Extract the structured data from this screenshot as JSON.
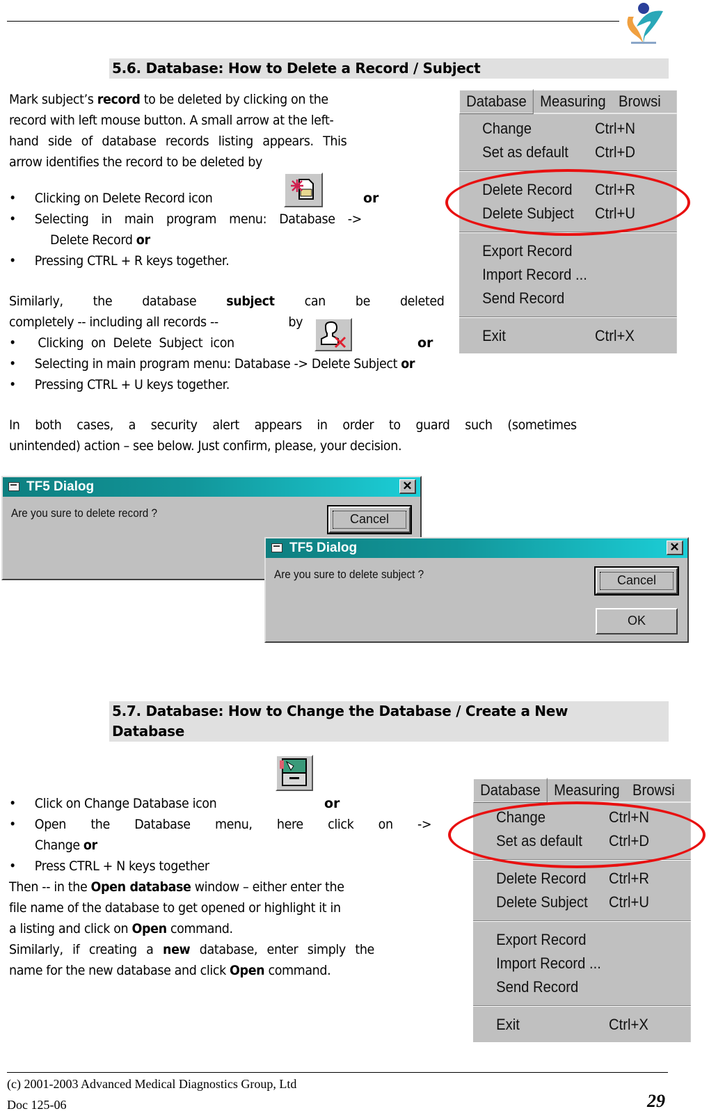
{
  "header": {
    "logo_icon": "heart-figure-logo-icon"
  },
  "section_56": {
    "heading": "5.6. Database: How to Delete a Record / Subject",
    "intro_lines": [
      [
        "Mark subject’s ",
        "record",
        " to be deleted by clicking on the"
      ],
      "record with left mouse button. A small arrow at the left-",
      "hand side of database records listing appears. This",
      "arrow identifies the record to be deleted by"
    ],
    "bullets_record": [
      {
        "text": "Clicking on Delete Record icon",
        "suffix": "or",
        "icon": "delete-record-icon"
      },
      {
        "text": "Selecting in main program menu: Database ->",
        "continuation": "Delete Record",
        "suffix": "or"
      },
      {
        "text": "Pressing CTRL + R keys together."
      }
    ],
    "subject_para": {
      "line1_words": [
        "Similarly,",
        "the",
        "database",
        "subject",
        "can",
        "be",
        "deleted"
      ],
      "line2_text": "completely -- including all records --",
      "line2_suffix": "by"
    },
    "bullets_subject": [
      {
        "text": "Clicking on Delete Subject icon",
        "suffix": "or",
        "icon": "delete-subject-icon"
      },
      {
        "text": "Selecting in main program menu: Database ->  Delete Subject",
        "suffix": "or"
      },
      {
        "text": "Pressing CTRL + U keys together."
      }
    ],
    "alert_para": [
      "In both cases, a security alert appears in order to guard such (sometimes",
      "unintended) action – see below. Just confirm, please, your decision."
    ]
  },
  "menu": {
    "bar": [
      "Database",
      "Measuring",
      "Browsi"
    ],
    "groups": [
      [
        {
          "label": "Change",
          "shortcut": "Ctrl+N"
        },
        {
          "label": "Set as default",
          "shortcut": "Ctrl+D"
        }
      ],
      [
        {
          "label": "Delete Record",
          "shortcut": "Ctrl+R"
        },
        {
          "label": "Delete Subject",
          "shortcut": "Ctrl+U"
        }
      ],
      [
        {
          "label": "Export Record",
          "shortcut": ""
        },
        {
          "label": "Import Record ...",
          "shortcut": ""
        },
        {
          "label": "Send Record",
          "shortcut": ""
        }
      ],
      [
        {
          "label": "Exit",
          "shortcut": "Ctrl+X"
        }
      ]
    ],
    "highlight_color": "#e81010"
  },
  "dialogs": [
    {
      "title": "TF5 Dialog",
      "message": "Are you sure to delete record ?",
      "cancel": "Cancel",
      "close": "✕"
    },
    {
      "title": "TF5 Dialog",
      "message": "Are you sure to delete subject ?",
      "cancel": "Cancel",
      "ok": "OK",
      "close": "✕"
    }
  ],
  "section_57": {
    "heading_line1": "5.7. Database: How to Change the Database / Create a New",
    "heading_line2": "Database",
    "bullets": [
      {
        "text": "Click on Change Database icon",
        "suffix": "or",
        "icon": "change-database-icon"
      },
      {
        "text_words": [
          "Open",
          "the",
          "Database",
          "menu,",
          "here",
          "click",
          "on",
          "->"
        ],
        "continuation": "Change",
        "suffix": "or"
      },
      {
        "text": "Press CTRL + N keys together"
      }
    ],
    "para": [
      [
        "Then -- in the ",
        "Open database",
        " window – either enter the"
      ],
      "file name of the database to get opened or highlight it in",
      [
        "a listing and click on ",
        "Open",
        " command."
      ],
      [
        "Similarly, if creating a ",
        "new",
        " database, enter simply the"
      ],
      [
        "name for the new database and click ",
        "Open",
        " command."
      ]
    ]
  },
  "footer": {
    "copyright": "(c) 2001-2003 Advanced Medical Diagnostics Group, Ltd",
    "doc_id": "Doc 125-06",
    "page_number": "29"
  },
  "colors": {
    "heading_bg": "#e0e0e0",
    "titlebar_start": "#0e7f80",
    "titlebar_end": "#1ccfd8",
    "window_face": "#c0c0c0"
  }
}
